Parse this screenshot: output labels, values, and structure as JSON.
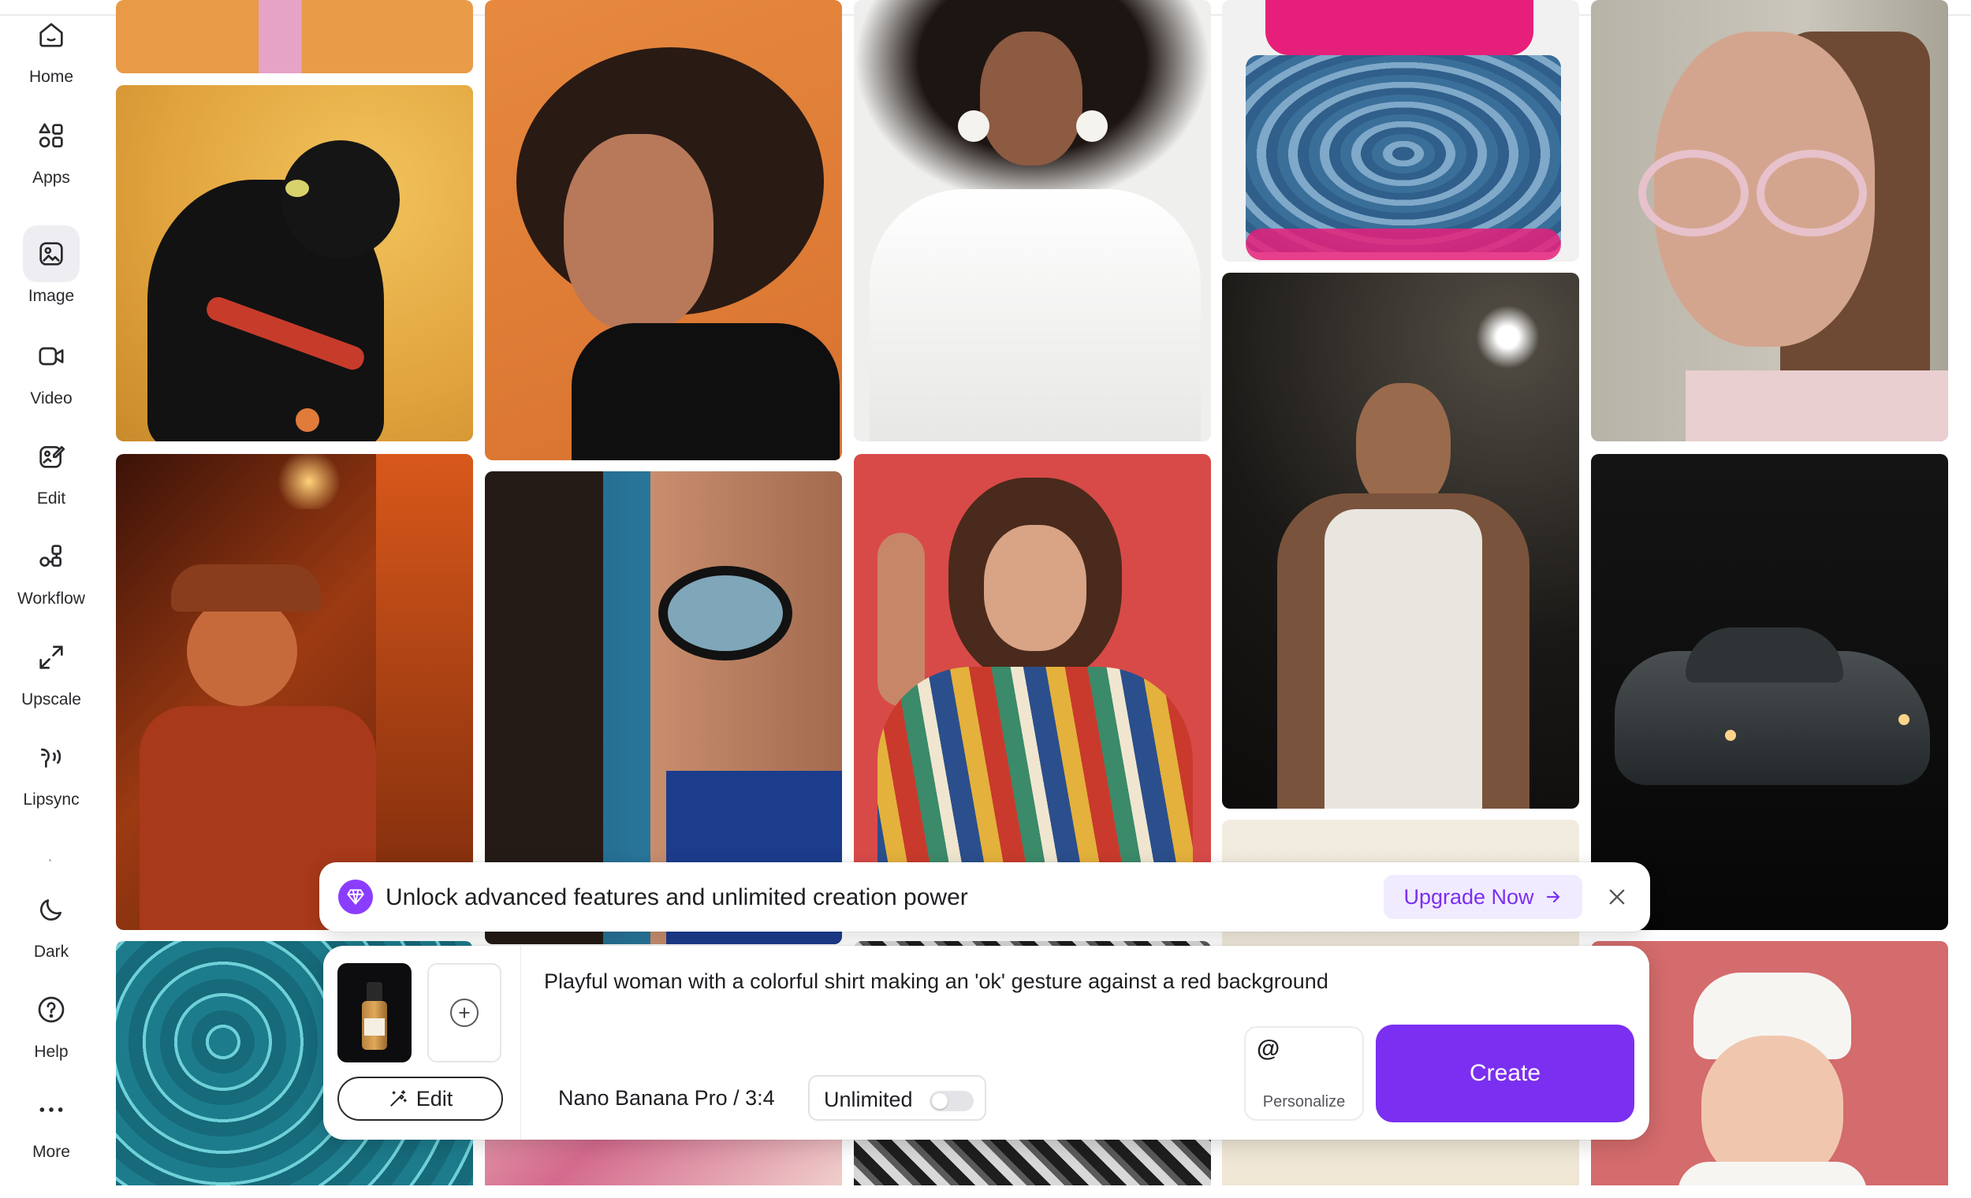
{
  "sidebar": {
    "items": [
      {
        "id": "home",
        "label": "Home",
        "icon": "home-icon"
      },
      {
        "id": "apps",
        "label": "Apps",
        "icon": "apps-icon"
      },
      {
        "id": "image",
        "label": "Image",
        "icon": "image-icon",
        "active": true
      },
      {
        "id": "video",
        "label": "Video",
        "icon": "video-icon"
      },
      {
        "id": "edit",
        "label": "Edit",
        "icon": "edit-icon"
      },
      {
        "id": "workflow",
        "label": "Workflow",
        "icon": "workflow-icon"
      },
      {
        "id": "upscale",
        "label": "Upscale",
        "icon": "upscale-icon"
      },
      {
        "id": "lipsync",
        "label": "Lipsync",
        "icon": "lipsync-icon"
      },
      {
        "id": "dark",
        "label": "Dark",
        "icon": "moon-icon"
      },
      {
        "id": "help",
        "label": "Help",
        "icon": "help-icon"
      },
      {
        "id": "more",
        "label": "More",
        "icon": "more-icon"
      }
    ]
  },
  "gallery": {
    "images": [
      "orange-pink-crop",
      "black-cat-red-collar",
      "curly-hair-woman-orange",
      "woman-white-shirt-earrings",
      "pink-liquid-glass-cube",
      "woman-round-glasses",
      "man-neon-bar",
      "woman-glasses-blue",
      "playful-woman-ok-gesture",
      "man-white-tank-top",
      "black-sports-car",
      "water-caustics",
      "pink-lips-crop",
      "black-white-texture",
      "cream-blank",
      "baby-chef-hat"
    ]
  },
  "banner": {
    "text": "Unlock advanced features and unlimited creation power",
    "upgrade_label": "Upgrade Now",
    "colors": {
      "accent": "#7b2ff0",
      "accent_bg": "#f1ebff"
    }
  },
  "prompt": {
    "text": "Playful woman with a colorful shirt making an 'ok' gesture against a red background",
    "model": "Nano Banana Pro / 3:4",
    "unlimited_label": "Unlimited",
    "unlimited_on": false,
    "edit_label": "Edit",
    "personalize_label": "Personalize",
    "personalize_symbol": "@",
    "create_label": "Create"
  }
}
